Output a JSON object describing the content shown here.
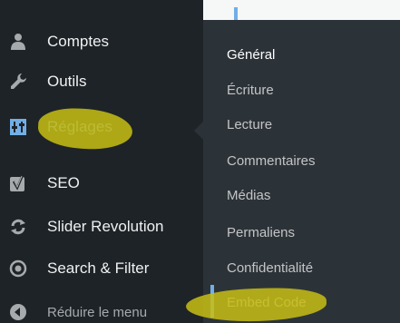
{
  "menu": {
    "items": [
      {
        "label": "Comptes",
        "icon": "users-icon"
      },
      {
        "label": "Outils",
        "icon": "wrench-icon"
      },
      {
        "label": "Réglages",
        "icon": "settings-icon"
      },
      {
        "label": "SEO",
        "icon": "yoast-seo-icon"
      },
      {
        "label": "Slider Revolution",
        "icon": "refresh-icon"
      },
      {
        "label": "Search & Filter",
        "icon": "target-icon"
      },
      {
        "label": "Réduire le menu",
        "icon": "collapse-arrow-icon"
      }
    ]
  },
  "submenu": {
    "items": [
      {
        "label": "Général"
      },
      {
        "label": "Écriture"
      },
      {
        "label": "Lecture"
      },
      {
        "label": "Commentaires"
      },
      {
        "label": "Médias"
      },
      {
        "label": "Permaliens"
      },
      {
        "label": "Confidentialité"
      },
      {
        "label": "Embed Code"
      }
    ]
  },
  "colors": {
    "menu_bg": "#1d2327",
    "submenu_bg": "#2c3338",
    "accent": "#72aee6",
    "highlight": "#c8be14"
  }
}
